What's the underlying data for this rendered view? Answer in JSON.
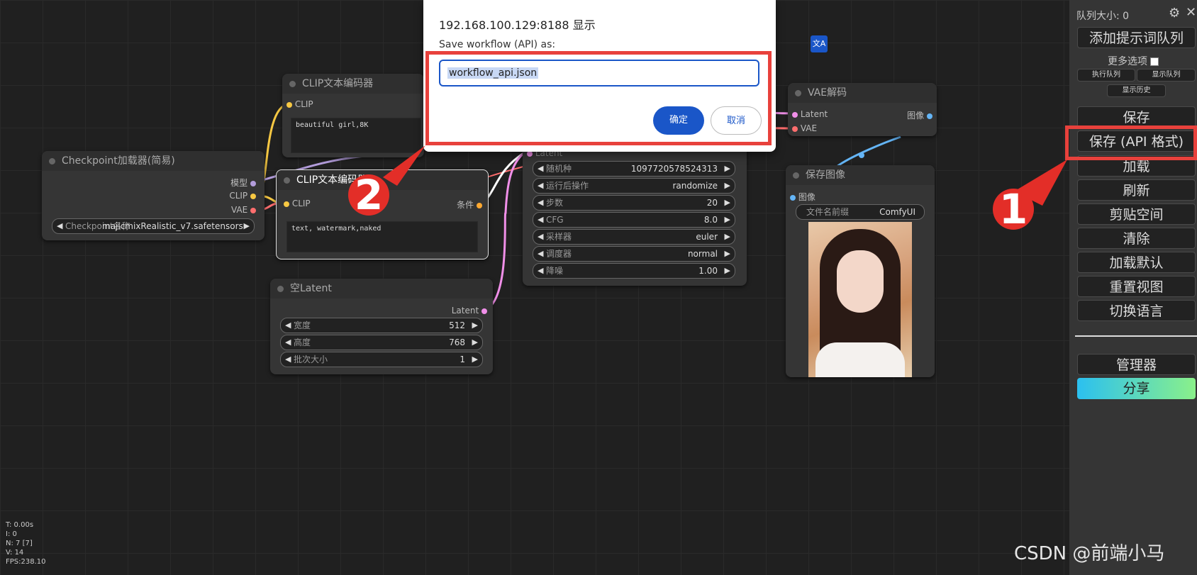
{
  "dialog": {
    "host": "192.168.100.129:8188 显示",
    "message": "Save workflow (API) as:",
    "input_value": "workflow_api.json",
    "ok_label": "确定",
    "cancel_label": "取消"
  },
  "nodes": {
    "checkpoint": {
      "title": "Checkpoint加载器(简易)",
      "out_model": "模型",
      "out_clip": "CLIP",
      "out_vae": "VAE",
      "widget_label": "Checkpoint名称",
      "widget_value": "majicmixRealistic_v7.safetensors"
    },
    "clip1": {
      "title": "CLIP文本编码器",
      "in_clip": "CLIP",
      "text": "beautiful girl,8K"
    },
    "clip2": {
      "title": "CLIP文本编码器",
      "in_clip": "CLIP",
      "out_cond": "条件",
      "text": "text, watermark,naked"
    },
    "latent": {
      "title": "空Latent",
      "out_latent": "Latent",
      "width_label": "宽度",
      "width_value": "512",
      "height_label": "高度",
      "height_value": "768",
      "batch_label": "批次大小",
      "batch_value": "1"
    },
    "ksampler": {
      "in_latent": "Latent",
      "seed_label": "随机种",
      "seed_value": "1097720578524313",
      "after_label": "运行后操作",
      "after_value": "randomize",
      "steps_label": "步数",
      "steps_value": "20",
      "cfg_label": "CFG",
      "cfg_value": "8.0",
      "sampler_label": "采样器",
      "sampler_value": "euler",
      "scheduler_label": "调度器",
      "scheduler_value": "normal",
      "denoise_label": "降噪",
      "denoise_value": "1.00"
    },
    "vae": {
      "title": "VAE解码",
      "in_latent": "Latent",
      "in_vae": "VAE",
      "out_image": "图像"
    },
    "save": {
      "title": "保存图像",
      "in_image": "图像",
      "prefix_label": "文件名前缀",
      "prefix_value": "ComfyUI"
    }
  },
  "panel": {
    "queue_size": "队列大小: 0",
    "queue_prompt": "添加提示词队列",
    "more_options": "更多选项",
    "exec_queue": "执行队列",
    "show_queue": "显示队列",
    "show_history": "显示历史",
    "save": "保存",
    "save_api": "保存 (API 格式)",
    "load": "加载",
    "refresh": "刷新",
    "clipspace": "剪贴空间",
    "clear": "清除",
    "load_default": "加载默认",
    "reset_view": "重置视图",
    "switch_lang": "切换语言",
    "manager": "管理器",
    "share": "分享"
  },
  "stats": {
    "t": "T: 0.00s",
    "i": "I: 0",
    "n": "N: 7 [7]",
    "v": "V: 14",
    "fps": "FPS:238.10"
  },
  "annotations": {
    "step1": "1",
    "step2": "2"
  },
  "watermark": "CSDN @前端小马",
  "translate_icon": "文A",
  "colors": {
    "accent_blue": "#1a56c8",
    "annotation_red": "#e8413c",
    "clip_yellow": "#f7c843",
    "latent_pink": "#f08fe8",
    "vae_red": "#ff6e6e",
    "image_blue": "#64b5f6"
  }
}
